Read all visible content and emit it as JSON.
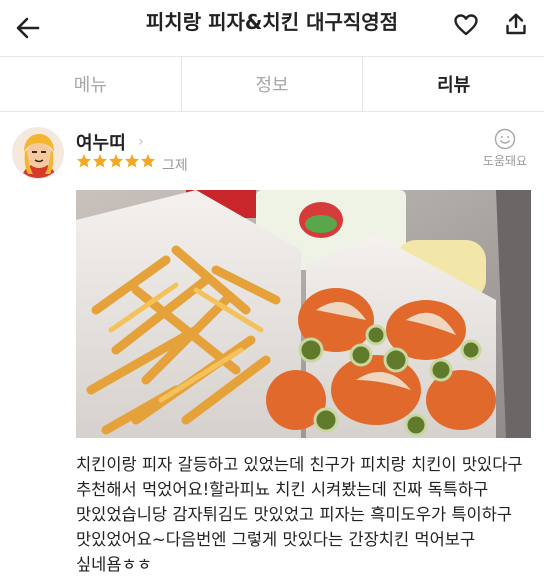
{
  "header": {
    "title": "피치랑 피자&치킨 대구직영점",
    "back_icon": "back-arrow-icon",
    "favorite_icon": "heart-outline-icon",
    "share_icon": "share-icon"
  },
  "tabs": [
    {
      "label": "메뉴",
      "active": false
    },
    {
      "label": "정보",
      "active": false
    },
    {
      "label": "리뷰",
      "active": true
    }
  ],
  "review": {
    "user_name": "여누띠",
    "rating": 5,
    "rating_max": 5,
    "rating_label": "그제",
    "helpful_label": "도움돼요",
    "helpful_icon": "smiley-face-icon",
    "text": "치킨이랑 피자 갈등하고 있었는데 친구가 피치랑 치킨이 맛있다구 추천해서 먹었어요!할라피뇨 치킨 시켜봤는데 진짜 독특하구 맛있었습니당 감자튀김도 맛있었고 피자는 흑미도우가 특이하구 맛있었어요~다음번엔 그렇게 맛있다는 간장치킨 먹어보구 싶네욤ㅎㅎ"
  },
  "colors": {
    "star": "#f5a623",
    "inactive_tab": "#a8a8a8",
    "divider": "#e6e6e6"
  }
}
